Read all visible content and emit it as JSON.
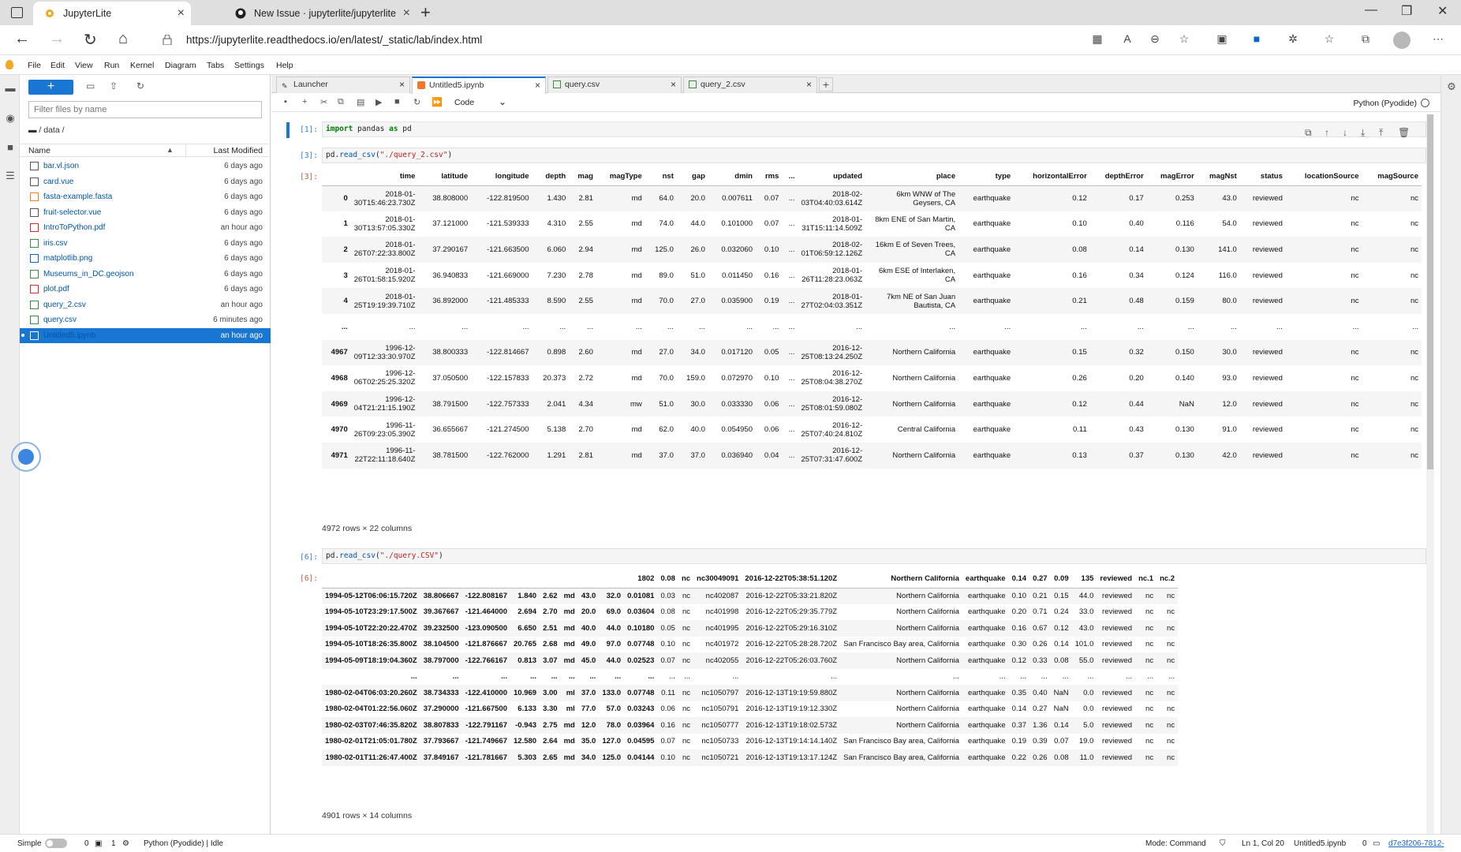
{
  "browser": {
    "tabs": [
      {
        "title": "JupyterLite"
      },
      {
        "title": "New Issue · jupyterlite/jupyterlite"
      }
    ],
    "url": "https://jupyterlite.readthedocs.io/en/latest/_static/lab/index.html"
  },
  "menu": [
    "File",
    "Edit",
    "View",
    "Run",
    "Kernel",
    "Diagram",
    "Tabs",
    "Settings",
    "Help"
  ],
  "filebrowser": {
    "new_label": "+",
    "filter_placeholder": "Filter files by name",
    "breadcrumb": "/ data /",
    "col_name": "Name",
    "col_modified": "Last Modified",
    "files": [
      {
        "name": "bar.vl.json",
        "modified": "6 days ago",
        "icon": "json-icon",
        "color": "#555555"
      },
      {
        "name": "card.vue",
        "modified": "6 days ago",
        "icon": "file-icon",
        "color": "#555555"
      },
      {
        "name": "fasta-example.fasta",
        "modified": "6 days ago",
        "icon": "image-icon",
        "color": "#e67e22"
      },
      {
        "name": "fruit-selector.vue",
        "modified": "6 days ago",
        "icon": "file-icon",
        "color": "#555555"
      },
      {
        "name": "IntroToPython.pdf",
        "modified": "an hour ago",
        "icon": "pdf-icon",
        "color": "#d32f2f"
      },
      {
        "name": "iris.csv",
        "modified": "6 days ago",
        "icon": "csv-icon",
        "color": "#388e3c"
      },
      {
        "name": "matplotlib.png",
        "modified": "6 days ago",
        "icon": "png-icon",
        "color": "#1565c0"
      },
      {
        "name": "Museums_in_DC.geojson",
        "modified": "6 days ago",
        "icon": "geojson-icon",
        "color": "#388e3c"
      },
      {
        "name": "plot.pdf",
        "modified": "6 days ago",
        "icon": "pdf-icon",
        "color": "#d32f2f"
      },
      {
        "name": "query_2.csv",
        "modified": "an hour ago",
        "icon": "csv-icon",
        "color": "#388e3c"
      },
      {
        "name": "query.csv",
        "modified": "6 minutes ago",
        "icon": "csv-icon",
        "color": "#388e3c"
      },
      {
        "name": "Untitled5.ipynb",
        "modified": "an hour ago",
        "icon": "notebook-icon",
        "color": "#ffffff",
        "selected": true
      }
    ]
  },
  "doc_tabs": [
    {
      "label": "Launcher",
      "icon": "launcher-icon"
    },
    {
      "label": "Untitled5.ipynb",
      "icon": "notebook-icon",
      "active": true
    },
    {
      "label": "query.csv",
      "icon": "csv-icon"
    },
    {
      "label": "query_2.csv",
      "icon": "csv-icon"
    }
  ],
  "toolbar": {
    "cell_type": "Code",
    "kernel": "Python (Pyodide)"
  },
  "cells": {
    "c1": {
      "prompt": "[1]:"
    },
    "c2": {
      "prompt": "[3]:",
      "out_prompt": "[3]:",
      "shape": "4972 rows × 22 columns"
    },
    "c3": {
      "prompt": "[6]:",
      "out_prompt": "[6]:",
      "shape": "4901 rows × 14 columns"
    }
  },
  "table1": {
    "columns": [
      "",
      "time",
      "latitude",
      "longitude",
      "depth",
      "mag",
      "magType",
      "nst",
      "gap",
      "dmin",
      "rms",
      "...",
      "updated",
      "place",
      "type",
      "horizontalError",
      "depthError",
      "magError",
      "magNst",
      "status",
      "locationSource",
      "magSource"
    ],
    "rows": [
      [
        "0",
        "2018-01-30T15:46:23.730Z",
        "38.808000",
        "-122.819500",
        "1.430",
        "2.81",
        "md",
        "64.0",
        "20.0",
        "0.007611",
        "0.07",
        "...",
        "2018-02-03T04:40:03.614Z",
        "6km WNW of The Geysers, CA",
        "earthquake",
        "0.12",
        "0.17",
        "0.253",
        "43.0",
        "reviewed",
        "nc",
        "nc"
      ],
      [
        "1",
        "2018-01-30T13:57:05.330Z",
        "37.121000",
        "-121.539333",
        "4.310",
        "2.55",
        "md",
        "74.0",
        "44.0",
        "0.101000",
        "0.07",
        "...",
        "2018-01-31T15:11:14.509Z",
        "8km ENE of San Martin, CA",
        "earthquake",
        "0.10",
        "0.40",
        "0.116",
        "54.0",
        "reviewed",
        "nc",
        "nc"
      ],
      [
        "2",
        "2018-01-26T07:22:33.800Z",
        "37.290167",
        "-121.663500",
        "6.060",
        "2.94",
        "md",
        "125.0",
        "26.0",
        "0.032060",
        "0.10",
        "...",
        "2018-02-01T06:59:12.126Z",
        "16km E of Seven Trees, CA",
        "earthquake",
        "0.08",
        "0.14",
        "0.130",
        "141.0",
        "reviewed",
        "nc",
        "nc"
      ],
      [
        "3",
        "2018-01-26T01:58:15.920Z",
        "36.940833",
        "-121.669000",
        "7.230",
        "2.78",
        "md",
        "89.0",
        "51.0",
        "0.011450",
        "0.16",
        "...",
        "2018-01-26T11:28:23.063Z",
        "6km ESE of Interlaken, CA",
        "earthquake",
        "0.16",
        "0.34",
        "0.124",
        "116.0",
        "reviewed",
        "nc",
        "nc"
      ],
      [
        "4",
        "2018-01-25T19:19:39.710Z",
        "36.892000",
        "-121.485333",
        "8.590",
        "2.55",
        "md",
        "70.0",
        "27.0",
        "0.035900",
        "0.19",
        "...",
        "2018-01-27T02:04:03.351Z",
        "7km NE of San Juan Bautista, CA",
        "earthquake",
        "0.21",
        "0.48",
        "0.159",
        "80.0",
        "reviewed",
        "nc",
        "nc"
      ],
      [
        "...",
        "...",
        "...",
        "...",
        "...",
        "...",
        "...",
        "...",
        "...",
        "...",
        "...",
        "...",
        "...",
        "...",
        "...",
        "...",
        "...",
        "...",
        "...",
        "...",
        "...",
        "..."
      ],
      [
        "4967",
        "1996-12-09T12:33:30.970Z",
        "38.800333",
        "-122.814667",
        "0.898",
        "2.60",
        "md",
        "27.0",
        "34.0",
        "0.017120",
        "0.05",
        "...",
        "2016-12-25T08:13:24.250Z",
        "Northern California",
        "earthquake",
        "0.15",
        "0.32",
        "0.150",
        "30.0",
        "reviewed",
        "nc",
        "nc"
      ],
      [
        "4968",
        "1996-12-06T02:25:25.320Z",
        "37.050500",
        "-122.157833",
        "20.373",
        "2.72",
        "md",
        "70.0",
        "159.0",
        "0.072970",
        "0.10",
        "...",
        "2016-12-25T08:04:38.270Z",
        "Northern California",
        "earthquake",
        "0.26",
        "0.20",
        "0.140",
        "93.0",
        "reviewed",
        "nc",
        "nc"
      ],
      [
        "4969",
        "1996-12-04T21:21:15.190Z",
        "38.791500",
        "-122.757333",
        "2.041",
        "4.34",
        "mw",
        "51.0",
        "30.0",
        "0.033330",
        "0.06",
        "...",
        "2016-12-25T08:01:59.080Z",
        "Northern California",
        "earthquake",
        "0.12",
        "0.44",
        "NaN",
        "12.0",
        "reviewed",
        "nc",
        "nc"
      ],
      [
        "4970",
        "1996-11-26T09:23:05.390Z",
        "36.655667",
        "-121.274500",
        "5.138",
        "2.70",
        "md",
        "62.0",
        "40.0",
        "0.054950",
        "0.06",
        "...",
        "2016-12-25T07:40:24.810Z",
        "Central California",
        "earthquake",
        "0.11",
        "0.43",
        "0.130",
        "91.0",
        "reviewed",
        "nc",
        "nc"
      ],
      [
        "4971",
        "1996-11-22T22:11:18.640Z",
        "38.781500",
        "-122.762000",
        "1.291",
        "2.81",
        "md",
        "37.0",
        "37.0",
        "0.036940",
        "0.04",
        "...",
        "2016-12-25T07:31:47.600Z",
        "Northern California",
        "earthquake",
        "0.13",
        "0.37",
        "0.130",
        "42.0",
        "reviewed",
        "nc",
        "nc"
      ]
    ]
  },
  "table2": {
    "columns": [
      "1994-05-12T06:06:15.720Z",
      "38.806667",
      "-122.808167",
      "1.840",
      "2.62",
      "md",
      "43.0",
      "32.0",
      "0.01081",
      "0.03",
      "nc",
      "nc402087",
      "2016-12-22T05:33:21.820Z",
      "Northern California",
      "earthquake",
      "0.10",
      "0.21",
      "0.15",
      "44.0",
      "reviewed",
      "nc",
      "nc"
    ],
    "header_labels": [
      "1802",
      "0.08",
      "nc",
      "nc30049091",
      "2016-12-22T05:38:51.120Z",
      "Northern California",
      "earthquake",
      "0.14",
      "0.27",
      "0.09",
      "135",
      "reviewed",
      "nc.1",
      "nc.2"
    ],
    "rows": [
      [
        "1994-05-12T06:06:15.720Z",
        "38.806667",
        "-122.808167",
        "1.840",
        "2.62",
        "md",
        "43.0",
        "32.0",
        "0.01081",
        "0.03",
        "nc",
        "nc402087",
        "2016-12-22T05:33:21.820Z",
        "Northern California",
        "earthquake",
        "0.10",
        "0.21",
        "0.15",
        "44.0",
        "reviewed",
        "nc",
        "nc"
      ],
      [
        "1994-05-10T23:29:17.500Z",
        "39.367667",
        "-121.464000",
        "2.694",
        "2.70",
        "md",
        "20.0",
        "69.0",
        "0.03604",
        "0.08",
        "nc",
        "nc401998",
        "2016-12-22T05:29:35.779Z",
        "Northern California",
        "earthquake",
        "0.20",
        "0.71",
        "0.24",
        "33.0",
        "reviewed",
        "nc",
        "nc"
      ],
      [
        "1994-05-10T22:20:22.470Z",
        "39.232500",
        "-123.090500",
        "6.650",
        "2.51",
        "md",
        "40.0",
        "44.0",
        "0.10180",
        "0.05",
        "nc",
        "nc401995",
        "2016-12-22T05:29:16.310Z",
        "Northern California",
        "earthquake",
        "0.16",
        "0.67",
        "0.12",
        "43.0",
        "reviewed",
        "nc",
        "nc"
      ],
      [
        "1994-05-10T18:26:35.800Z",
        "38.104500",
        "-121.876667",
        "20.765",
        "2.68",
        "md",
        "49.0",
        "97.0",
        "0.07748",
        "0.10",
        "nc",
        "nc401972",
        "2016-12-22T05:28:28.720Z",
        "San Francisco Bay area, California",
        "earthquake",
        "0.30",
        "0.26",
        "0.14",
        "101.0",
        "reviewed",
        "nc",
        "nc"
      ],
      [
        "1994-05-09T18:19:04.360Z",
        "38.797000",
        "-122.766167",
        "0.813",
        "3.07",
        "md",
        "45.0",
        "44.0",
        "0.02523",
        "0.07",
        "nc",
        "nc402055",
        "2016-12-22T05:26:03.760Z",
        "Northern California",
        "earthquake",
        "0.12",
        "0.33",
        "0.08",
        "55.0",
        "reviewed",
        "nc",
        "nc"
      ],
      [
        "...",
        "...",
        "...",
        "...",
        "...",
        "...",
        "...",
        "...",
        "...",
        "...",
        "...",
        "...",
        "...",
        "...",
        "...",
        "...",
        "...",
        "...",
        "...",
        "...",
        "...",
        "..."
      ],
      [
        "1980-02-04T06:03:20.260Z",
        "38.734333",
        "-122.410000",
        "10.969",
        "3.00",
        "ml",
        "37.0",
        "133.0",
        "0.07748",
        "0.11",
        "nc",
        "nc1050797",
        "2016-12-13T19:19:59.880Z",
        "Northern California",
        "earthquake",
        "0.35",
        "0.40",
        "NaN",
        "0.0",
        "reviewed",
        "nc",
        "nc"
      ],
      [
        "1980-02-04T01:22:56.060Z",
        "37.290000",
        "-121.667500",
        "6.133",
        "3.30",
        "ml",
        "77.0",
        "57.0",
        "0.03243",
        "0.06",
        "nc",
        "nc1050791",
        "2016-12-13T19:19:12.330Z",
        "Northern California",
        "earthquake",
        "0.14",
        "0.27",
        "NaN",
        "0.0",
        "reviewed",
        "nc",
        "nc"
      ],
      [
        "1980-02-03T07:46:35.820Z",
        "38.807833",
        "-122.791167",
        "-0.943",
        "2.75",
        "md",
        "12.0",
        "78.0",
        "0.03964",
        "0.16",
        "nc",
        "nc1050777",
        "2016-12-13T19:18:02.573Z",
        "Northern California",
        "earthquake",
        "0.37",
        "1.36",
        "0.14",
        "5.0",
        "reviewed",
        "nc",
        "nc"
      ],
      [
        "1980-02-01T21:05:01.780Z",
        "37.793667",
        "-121.749667",
        "12.580",
        "2.64",
        "md",
        "35.0",
        "127.0",
        "0.04595",
        "0.07",
        "nc",
        "nc1050733",
        "2016-12-13T19:14:14.140Z",
        "San Francisco Bay area, California",
        "earthquake",
        "0.19",
        "0.39",
        "0.07",
        "19.0",
        "reviewed",
        "nc",
        "nc"
      ],
      [
        "1980-02-01T11:26:47.400Z",
        "37.849167",
        "-121.781667",
        "5.303",
        "2.65",
        "md",
        "34.0",
        "125.0",
        "0.04144",
        "0.10",
        "nc",
        "nc1050721",
        "2016-12-13T19:13:17.124Z",
        "San Francisco Bay area, California",
        "earthquake",
        "0.22",
        "0.26",
        "0.08",
        "11.0",
        "reviewed",
        "nc",
        "nc"
      ]
    ]
  },
  "status": {
    "mode_toggle": "Simple",
    "zero": "0",
    "one": "1",
    "kernel_status": "Python (Pyodide) | Idle",
    "mode": "Mode: Command",
    "position": "Ln 1, Col 20",
    "file": "Untitled5.ipynb",
    "count": "0",
    "hash": "d7e3f206-7812-"
  }
}
